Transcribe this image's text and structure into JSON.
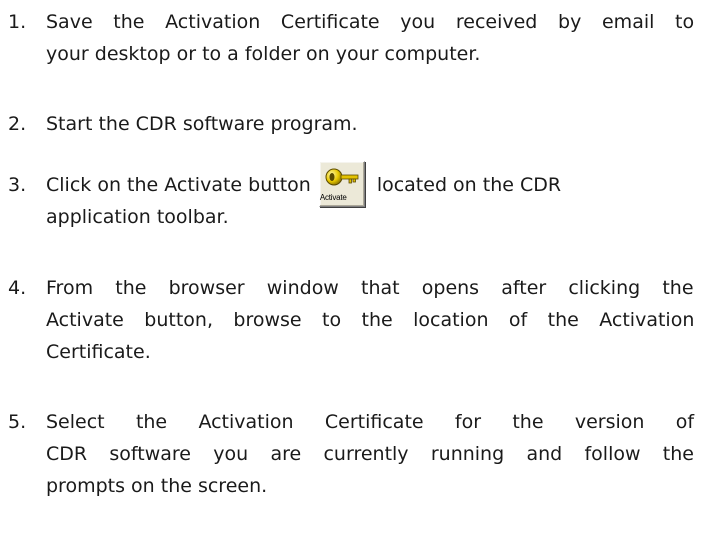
{
  "steps": [
    {
      "number": "1.",
      "lines": [
        "Save the Activation Certificate you received by email to",
        "your desktop or to a folder on your computer."
      ]
    },
    {
      "number": "2.",
      "lines": [
        "Start the CDR software program."
      ]
    },
    {
      "number": "3.",
      "before_button": "Click on the Activate button",
      "after_button": "located on the CDR",
      "line2": "application toolbar.",
      "button": {
        "label": "Activate",
        "icon": "key-icon"
      }
    },
    {
      "number": "4.",
      "lines": [
        "From the browser window that opens after clicking the",
        "Activate button, browse to the location of the Activation",
        "Certificate."
      ]
    },
    {
      "number": "5.",
      "lines": [
        "Select the Activation Certificate for the version of",
        "CDR software you are currently running and follow the",
        "prompts on the screen."
      ]
    }
  ]
}
